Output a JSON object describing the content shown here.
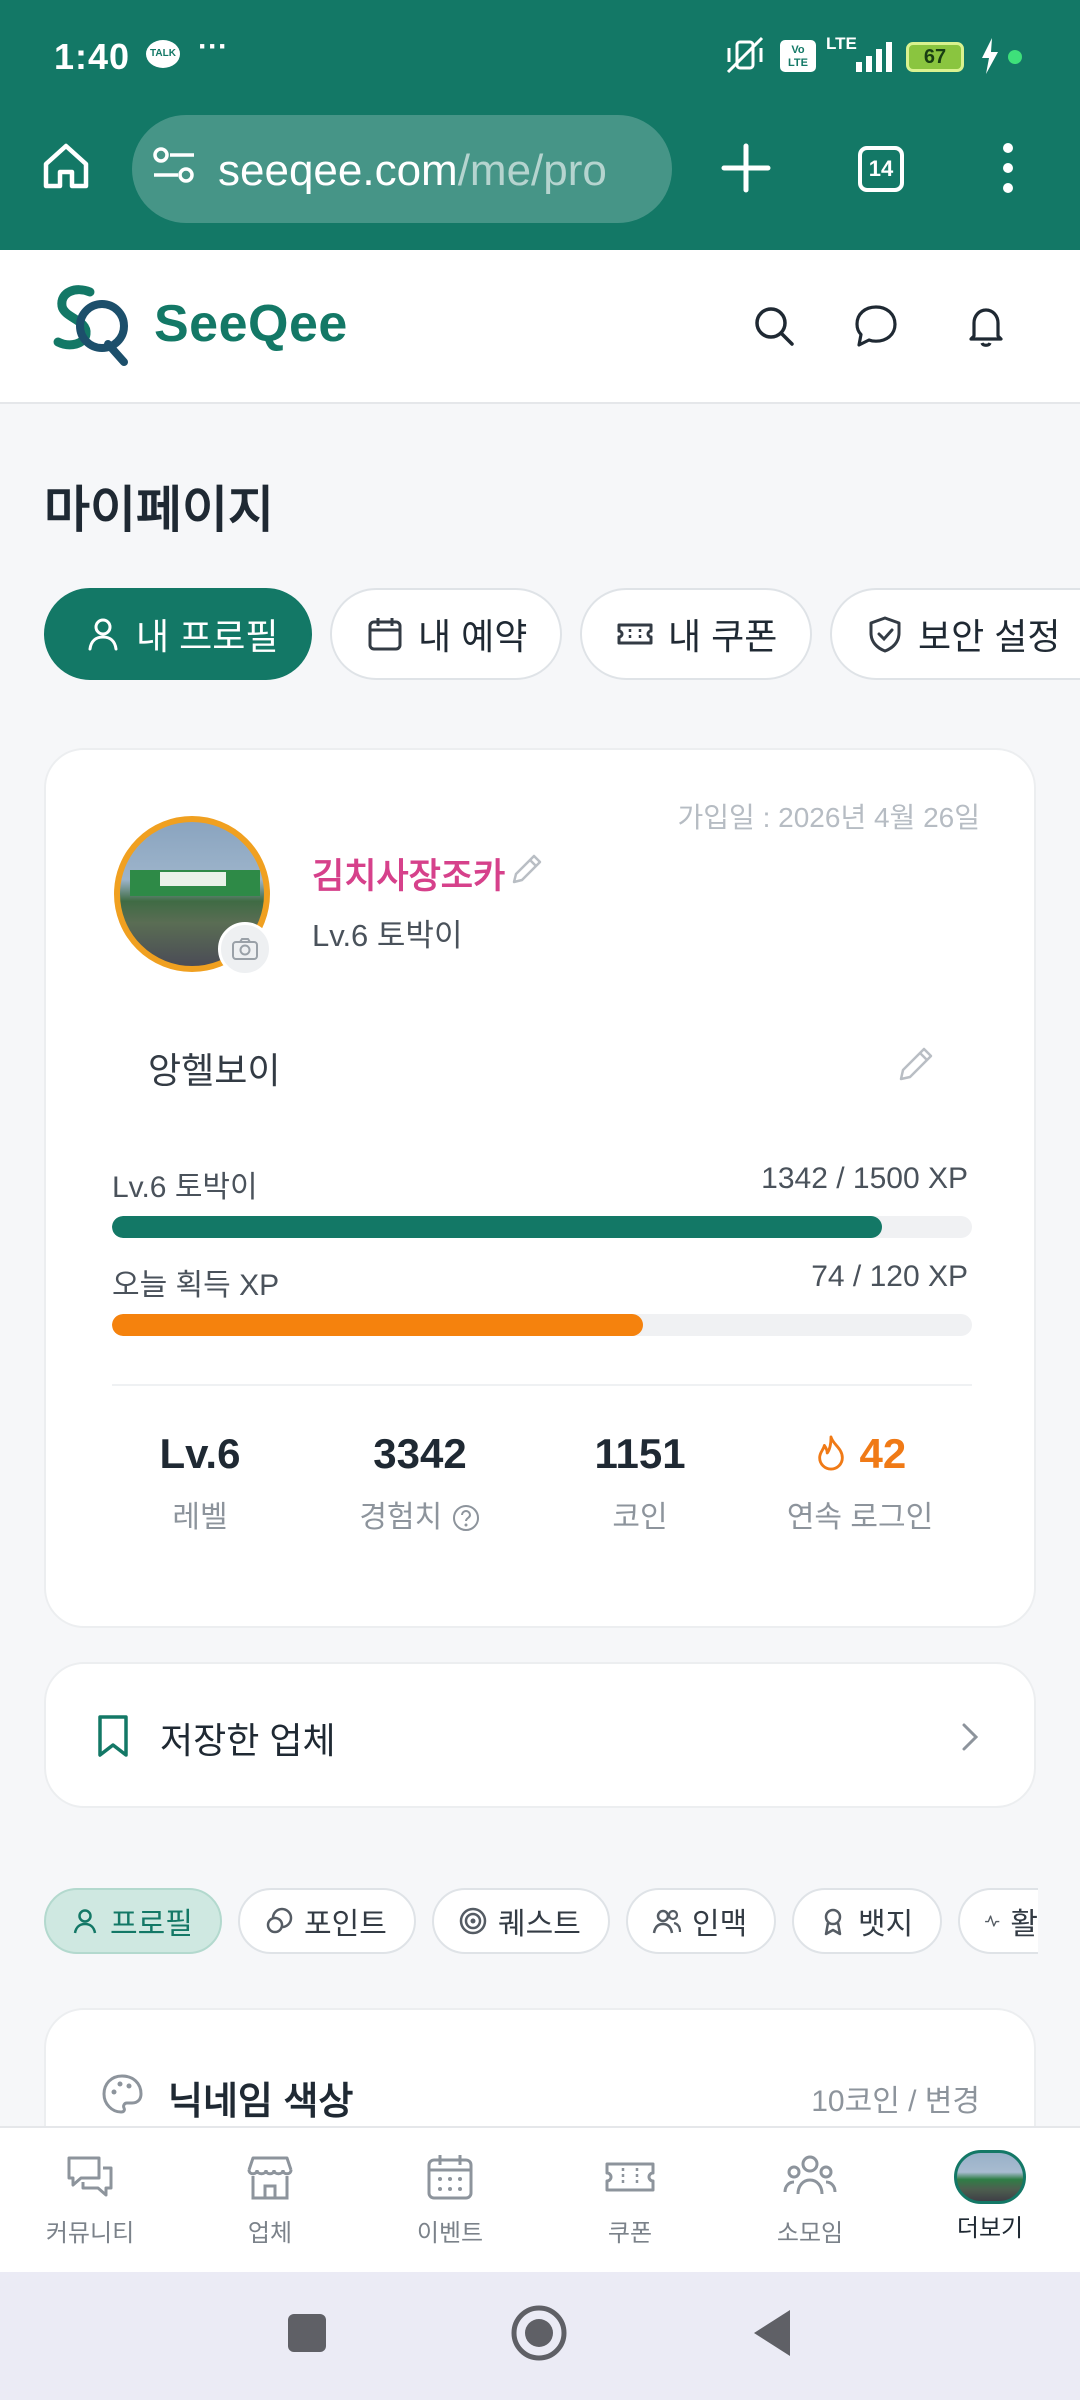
{
  "status_bar": {
    "time": "1:40",
    "talk_badge": "TALK",
    "overflow": "···",
    "volte": "Vo LTE",
    "network": "LTE",
    "battery": "67"
  },
  "browser": {
    "url_host": "seeqee.com",
    "url_path": "/me/pro",
    "tab_count": "14"
  },
  "header": {
    "brand": "SeeQee"
  },
  "page": {
    "title": "마이페이지",
    "tabs": [
      {
        "label": "내 프로필",
        "icon": "user-icon"
      },
      {
        "label": "내 예약",
        "icon": "calendar-icon"
      },
      {
        "label": "내 쿠폰",
        "icon": "ticket-icon"
      },
      {
        "label": "보안 설정",
        "icon": "shield-icon"
      }
    ]
  },
  "profile": {
    "join_date": "가입일 : 2026년 4월 26일",
    "nickname": "김치사장조카",
    "level_title": "Lv.6 토박이",
    "bio": "앙헬보이",
    "level_bar": {
      "label": "Lv.6 토박이",
      "value": "1342 / 1500 XP",
      "fraction": 0.895
    },
    "daily_bar": {
      "label": "오늘 획득 XP",
      "value": "74 / 120 XP",
      "fraction": 0.617
    },
    "stats": [
      {
        "value": "Lv.6",
        "label": "레벨"
      },
      {
        "value": "3342",
        "label": "경험치"
      },
      {
        "value": "1151",
        "label": "코인"
      },
      {
        "value": "42",
        "label": "연속 로그인"
      }
    ]
  },
  "saved": {
    "label": "저장한 업체"
  },
  "sub_tabs": [
    {
      "label": "프로필",
      "icon": "user-icon"
    },
    {
      "label": "포인트",
      "icon": "coin-icon"
    },
    {
      "label": "퀘스트",
      "icon": "target-icon"
    },
    {
      "label": "인맥",
      "icon": "people-icon"
    },
    {
      "label": "뱃지",
      "icon": "badge-icon"
    },
    {
      "label": "활",
      "icon": "activity-icon"
    }
  ],
  "nickname_color": {
    "title": "닉네임 색상",
    "price": "10코인 / 변경"
  },
  "bottom_nav": [
    {
      "label": "커뮤니티",
      "icon": "chat-icon"
    },
    {
      "label": "업체",
      "icon": "store-icon"
    },
    {
      "label": "이벤트",
      "icon": "calendar-icon"
    },
    {
      "label": "쿠폰",
      "icon": "ticket-icon"
    },
    {
      "label": "소모임",
      "icon": "group-icon"
    },
    {
      "label": "더보기",
      "icon": "avatar-icon"
    }
  ],
  "colors": {
    "brand": "#137866",
    "nickname": "#d6418b",
    "xp_bar": "#137866",
    "daily_bar": "#f5820d",
    "streak": "#f07a16"
  }
}
